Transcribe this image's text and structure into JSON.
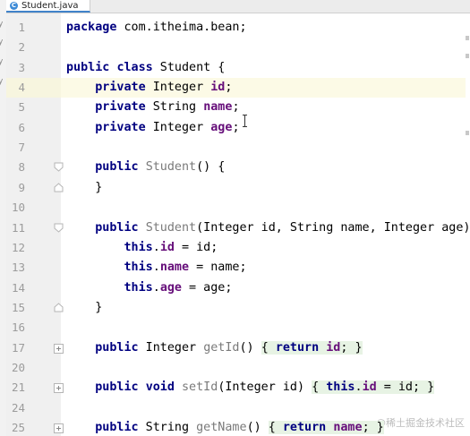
{
  "tab": {
    "icon": "C",
    "label": "Student.java"
  },
  "left_panel": {
    "chars": [
      "y",
      "y",
      "y",
      "y"
    ]
  },
  "lines": [
    {
      "n": "1",
      "tokens": [
        {
          "t": "package",
          "c": "kw"
        },
        {
          "t": " com.itheima.bean;",
          "c": ""
        }
      ]
    },
    {
      "n": "2",
      "tokens": []
    },
    {
      "n": "3",
      "tokens": [
        {
          "t": "public",
          "c": "kw"
        },
        {
          "t": " ",
          "c": ""
        },
        {
          "t": "class",
          "c": "kw"
        },
        {
          "t": " Student {",
          "c": ""
        }
      ]
    },
    {
      "n": "4",
      "tokens": [
        {
          "t": "    ",
          "c": ""
        },
        {
          "t": "private",
          "c": "kw"
        },
        {
          "t": " Integer ",
          "c": ""
        },
        {
          "t": "id",
          "c": "fld"
        },
        {
          "t": ";",
          "c": ""
        }
      ]
    },
    {
      "n": "5",
      "tokens": [
        {
          "t": "    ",
          "c": ""
        },
        {
          "t": "private",
          "c": "kw"
        },
        {
          "t": " String ",
          "c": ""
        },
        {
          "t": "name",
          "c": "fld"
        },
        {
          "t": ";",
          "c": ""
        }
      ]
    },
    {
      "n": "6",
      "tokens": [
        {
          "t": "    ",
          "c": ""
        },
        {
          "t": "private",
          "c": "kw"
        },
        {
          "t": " Integer ",
          "c": ""
        },
        {
          "t": "age",
          "c": "fld"
        },
        {
          "t": ";",
          "c": ""
        }
      ]
    },
    {
      "n": "7",
      "tokens": []
    },
    {
      "n": "8",
      "tokens": [
        {
          "t": "    ",
          "c": ""
        },
        {
          "t": "public",
          "c": "kw"
        },
        {
          "t": " ",
          "c": ""
        },
        {
          "t": "Student",
          "c": "mth"
        },
        {
          "t": "() {",
          "c": ""
        }
      ]
    },
    {
      "n": "9",
      "tokens": [
        {
          "t": "    }",
          "c": ""
        }
      ]
    },
    {
      "n": "10",
      "tokens": []
    },
    {
      "n": "11",
      "tokens": [
        {
          "t": "    ",
          "c": ""
        },
        {
          "t": "public",
          "c": "kw"
        },
        {
          "t": " ",
          "c": ""
        },
        {
          "t": "Student",
          "c": "mth"
        },
        {
          "t": "(Integer id, String name, Integer age) {",
          "c": ""
        }
      ]
    },
    {
      "n": "12",
      "tokens": [
        {
          "t": "        ",
          "c": ""
        },
        {
          "t": "this",
          "c": "kw"
        },
        {
          "t": ".",
          "c": ""
        },
        {
          "t": "id",
          "c": "fld"
        },
        {
          "t": " = id;",
          "c": ""
        }
      ]
    },
    {
      "n": "13",
      "tokens": [
        {
          "t": "        ",
          "c": ""
        },
        {
          "t": "this",
          "c": "kw"
        },
        {
          "t": ".",
          "c": ""
        },
        {
          "t": "name",
          "c": "fld"
        },
        {
          "t": " = name;",
          "c": ""
        }
      ]
    },
    {
      "n": "14",
      "tokens": [
        {
          "t": "        ",
          "c": ""
        },
        {
          "t": "this",
          "c": "kw"
        },
        {
          "t": ".",
          "c": ""
        },
        {
          "t": "age",
          "c": "fld"
        },
        {
          "t": " = age;",
          "c": ""
        }
      ]
    },
    {
      "n": "15",
      "tokens": [
        {
          "t": "    }",
          "c": ""
        }
      ]
    },
    {
      "n": "16",
      "tokens": []
    },
    {
      "n": "17",
      "tokens": [
        {
          "t": "    ",
          "c": ""
        },
        {
          "t": "public",
          "c": "kw"
        },
        {
          "t": " Integer ",
          "c": ""
        },
        {
          "t": "getId",
          "c": "mth"
        },
        {
          "t": "() ",
          "c": ""
        },
        {
          "t": "{ ",
          "c": "fb"
        },
        {
          "t": "return",
          "c": "kw fb"
        },
        {
          "t": " ",
          "c": "fb"
        },
        {
          "t": "id",
          "c": "fld fb"
        },
        {
          "t": "; }",
          "c": "fb"
        }
      ]
    },
    {
      "n": "20",
      "tokens": []
    },
    {
      "n": "21",
      "tokens": [
        {
          "t": "    ",
          "c": ""
        },
        {
          "t": "public",
          "c": "kw"
        },
        {
          "t": " ",
          "c": ""
        },
        {
          "t": "void",
          "c": "kw"
        },
        {
          "t": " ",
          "c": ""
        },
        {
          "t": "setId",
          "c": "mth"
        },
        {
          "t": "(Integer id) ",
          "c": ""
        },
        {
          "t": "{ ",
          "c": "fb"
        },
        {
          "t": "this",
          "c": "kw fb"
        },
        {
          "t": ".",
          "c": "fb"
        },
        {
          "t": "id",
          "c": "fld fb"
        },
        {
          "t": " = id; }",
          "c": "fb"
        }
      ]
    },
    {
      "n": "24",
      "tokens": []
    },
    {
      "n": "25",
      "tokens": [
        {
          "t": "    ",
          "c": ""
        },
        {
          "t": "public",
          "c": "kw"
        },
        {
          "t": " String ",
          "c": ""
        },
        {
          "t": "getName",
          "c": "mth"
        },
        {
          "t": "() ",
          "c": ""
        },
        {
          "t": "{ ",
          "c": "fb"
        },
        {
          "t": "return",
          "c": "kw fb"
        },
        {
          "t": " ",
          "c": "fb"
        },
        {
          "t": "name",
          "c": "fld fb"
        },
        {
          "t": "; }",
          "c": "fb"
        }
      ]
    }
  ],
  "folds": [
    {
      "line": "8",
      "kind": "open"
    },
    {
      "line": "9",
      "kind": "close"
    },
    {
      "line": "11",
      "kind": "open"
    },
    {
      "line": "15",
      "kind": "close"
    },
    {
      "line": "17",
      "kind": "collapsed"
    },
    {
      "line": "21",
      "kind": "collapsed"
    },
    {
      "line": "25",
      "kind": "collapsed"
    }
  ],
  "current_line": "4",
  "watermark": "@稀土掘金技术社区"
}
